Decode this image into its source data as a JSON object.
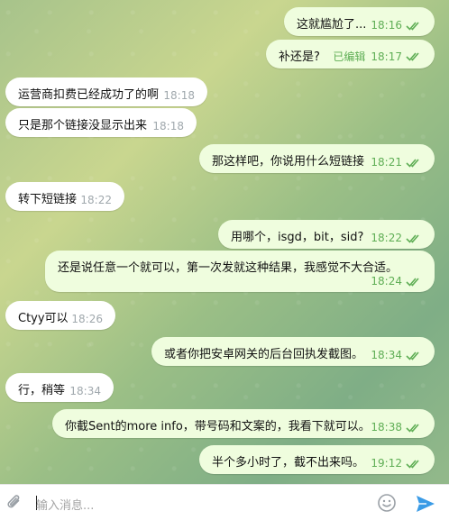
{
  "messages": [
    {
      "id": "m1",
      "dir": "out",
      "text": "这就尴尬了...",
      "time": "18:16",
      "edited": false,
      "read": true
    },
    {
      "id": "m2",
      "dir": "out",
      "text": "补还是?",
      "time": "18:17",
      "edited": true,
      "edited_label": "已编辑",
      "read": true
    },
    {
      "id": "m3",
      "dir": "in",
      "text": "运营商扣费已经成功了的啊",
      "time": "18:18"
    },
    {
      "id": "m4",
      "dir": "in",
      "text": "只是那个链接没显示出来",
      "time": "18:18"
    },
    {
      "id": "m5",
      "dir": "out",
      "text": "那这样吧，你说用什么短链接",
      "time": "18:21",
      "edited": false,
      "read": true
    },
    {
      "id": "m6",
      "dir": "in",
      "text": "转下短链接",
      "time": "18:22"
    },
    {
      "id": "m7",
      "dir": "out",
      "text": "用哪个，isgd，bit，sid?",
      "time": "18:22",
      "edited": false,
      "read": true
    },
    {
      "id": "m8",
      "dir": "out",
      "text": "还是说任意一个就可以，第一次发就这种结果，我感觉不大合适。",
      "time": "18:24",
      "edited": false,
      "read": true
    },
    {
      "id": "m9",
      "dir": "in",
      "text": "Ctyy可以",
      "time": "18:26"
    },
    {
      "id": "m10",
      "dir": "out",
      "text": "或者你把安卓网关的后台回执发截图。",
      "time": "18:34",
      "edited": false,
      "read": true
    },
    {
      "id": "m11",
      "dir": "in",
      "text": "行，稍等",
      "time": "18:34"
    },
    {
      "id": "m12",
      "dir": "out",
      "text": "你截Sent的more info，带号码和文案的，我看下就可以。",
      "time": "18:38",
      "edited": false,
      "read": true
    },
    {
      "id": "m13",
      "dir": "out",
      "text": "半个多小时了，截不出来吗。",
      "time": "19:12",
      "edited": false,
      "read": true
    }
  ],
  "input": {
    "placeholder": "输入消息...",
    "attach_icon": "paperclip-icon",
    "emoji_icon": "emoji-icon",
    "send_icon": "send-icon"
  },
  "colors": {
    "incoming_bubble": "#ffffff",
    "outgoing_bubble": "#effdde",
    "read_ticks": "#5fae55",
    "send_accent": "#3a9be6"
  }
}
